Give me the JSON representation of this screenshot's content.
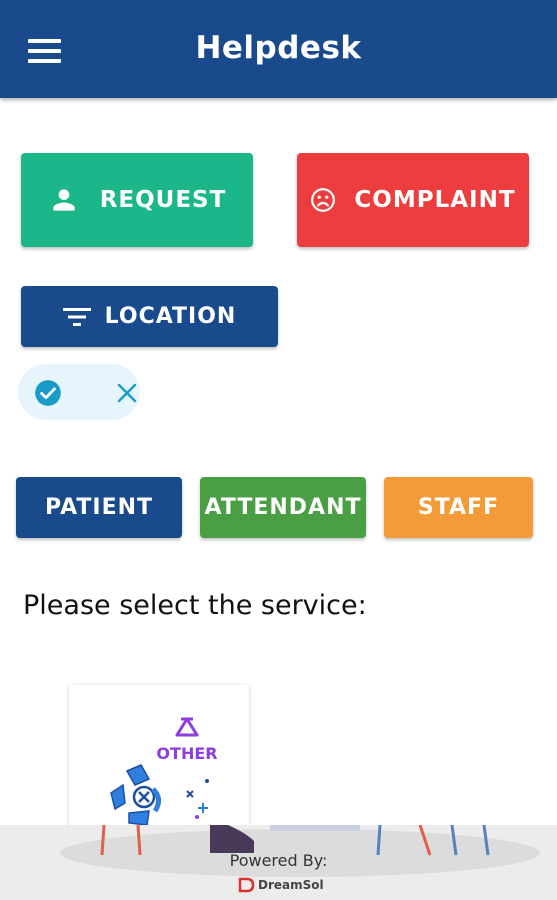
{
  "header": {
    "title": "Helpdesk",
    "menu_icon": "menu-icon"
  },
  "type_buttons": {
    "request": {
      "label": "REQUEST",
      "icon": "person-icon",
      "color": "#1cb68b"
    },
    "complaint": {
      "label": "COMPLAINT",
      "icon": "sad-face-icon",
      "color": "#ee3d3e"
    }
  },
  "filter": {
    "location_label": "LOCATION",
    "icon": "filter-icon"
  },
  "chip": {
    "check_icon": "check-circle-icon",
    "close_icon": "close-icon"
  },
  "categories": {
    "patient": {
      "label": "PATIENT",
      "color": "#194b8c"
    },
    "attendant": {
      "label": "ATTENDANT",
      "color": "#4a9f45"
    },
    "staff": {
      "label": "STAFF",
      "color": "#f29b38"
    }
  },
  "service_prompt": "Please select the service:",
  "services": [
    {
      "label": "OTHER",
      "icon": "other-service-icon"
    }
  ],
  "footer": {
    "powered_by": "Powered By:",
    "brand": "DreamSol"
  }
}
